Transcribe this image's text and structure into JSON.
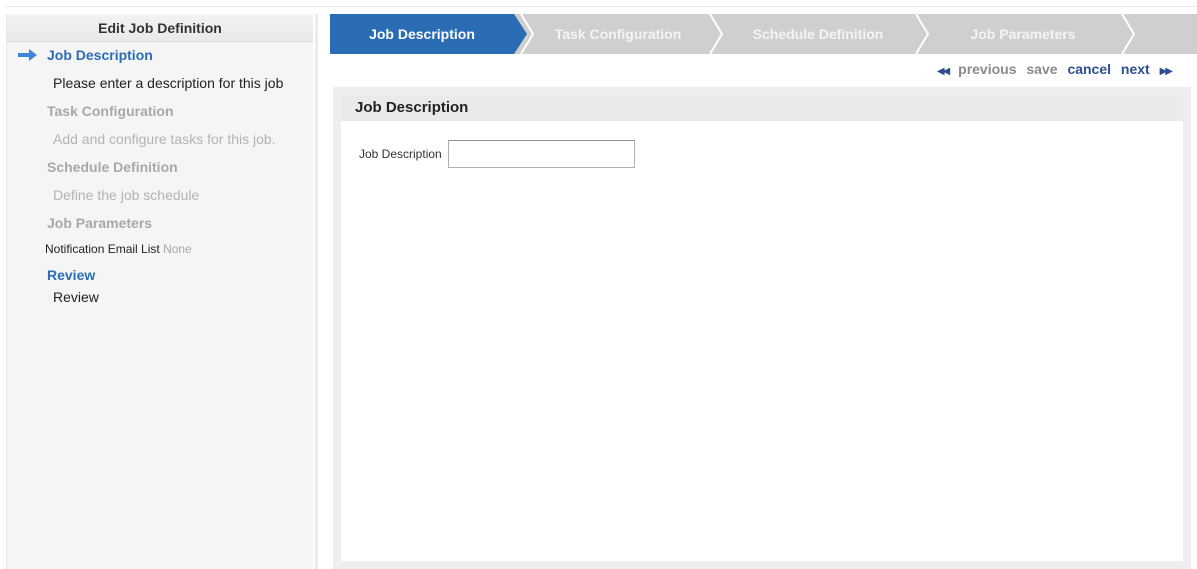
{
  "sidebar": {
    "title": "Edit Job Definition",
    "steps": [
      {
        "title": "Job Description",
        "description": "Please enter a description for this job",
        "state": "active"
      },
      {
        "title": "Task Configuration",
        "description": "Add and configure tasks for this job.",
        "state": "disabled"
      },
      {
        "title": "Schedule Definition",
        "description": "Define the job schedule",
        "state": "disabled"
      },
      {
        "title": "Job Parameters",
        "notification_label": "Notification Email List",
        "notification_value": "None",
        "state": "disabled"
      },
      {
        "title": "Review",
        "description": "Review",
        "state": "enabled"
      }
    ]
  },
  "tabs": [
    {
      "label": "Job Description",
      "active": true
    },
    {
      "label": "Task Configuration",
      "active": false
    },
    {
      "label": "Schedule Definition",
      "active": false
    },
    {
      "label": "Job Parameters",
      "active": false
    }
  ],
  "nav": {
    "previous": "previous",
    "save": "save",
    "cancel": "cancel",
    "next": "next",
    "previous_icon": "double-left-triangle",
    "next_icon": "double-right-triangle"
  },
  "panel": {
    "header": "Job Description",
    "field_label": "Job Description",
    "field_value": ""
  },
  "colors": {
    "active_tab": "#2a6db5",
    "inactive_tab": "#cfcfcf",
    "link": "#2e4e92",
    "disabled_text": "#a8a8a8"
  }
}
